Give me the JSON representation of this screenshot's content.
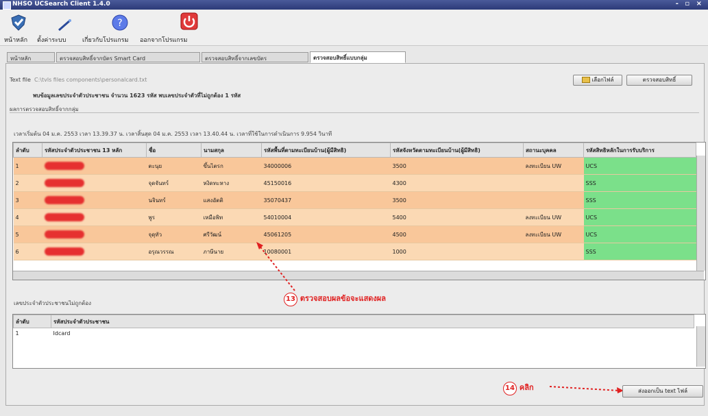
{
  "window": {
    "title": "NHSO UCSearch Client 1.4.0",
    "controls": "- ▫ ×"
  },
  "toolbar": {
    "items": [
      {
        "label": "หน้าหลัก",
        "icon": "home-shield-icon"
      },
      {
        "label": "ตั้งค่าระบบ",
        "icon": "settings-wand-icon"
      },
      {
        "label": "เกี่ยวกับโปรแกรม",
        "icon": "help-icon"
      },
      {
        "label": "ออกจากโปรแกรม",
        "icon": "power-icon"
      }
    ]
  },
  "tabs": [
    {
      "label": "หน้าหลัก",
      "active": false
    },
    {
      "label": "ตรวจสอบสิทธิ์จากบัตร Smart Card",
      "active": false
    },
    {
      "label": "ตรวจสอบสิทธิ์จากเลขบัตร",
      "active": false
    },
    {
      "label": "ตรวจสอบสิทธิ์แบบกลุ่ม",
      "active": true
    }
  ],
  "file_row": {
    "label": "Text file",
    "path": "C:\\tvls files components\\personalcard.txt",
    "browse_label": "เลือกไฟล์",
    "check_label": "ตรวจสอบสิทธิ์"
  },
  "summary": "พบข้อมูลเลขประจำตัวประชาชน จำนวน 1623 รหัส พบเลขประจำตัวที่ไม่ถูกต้อง 1 รหัส",
  "section1_title": "ผลการตรวจสอบสิทธิ์จากกลุ่ม",
  "timing": "เวลาเริ่มต้น 04 ม.ค. 2553 เวลา 13.39.37 น.  เวลาสิ้นสุด 04 ม.ค. 2553 เวลา 13.40.44 น.  เวลาที่ใช้ในการดำเนินการ 9.954 วินาที",
  "grid": {
    "columns": [
      "ลำดับ",
      "รหัสประจำตัวประชาชน 13 หลัก",
      "ชื่อ",
      "นามสกุล",
      "รหัสพื้นที่ตามทะเบียนบ้าน(ผู้มีสิทธิ)",
      "รหัสจังหวัดตามทะเบียนบ้าน(ผู้มีสิทธิ)",
      "สถานะบุคคล",
      "รหัสสิทธิหลักในการรับบริการ"
    ],
    "rows": [
      {
        "no": "1",
        "first": "ตะนุย",
        "last": "ขึ้นไตรก",
        "area": "34000006",
        "prov": "3500",
        "status": "ลงทะเบียน UW",
        "right": "UCS"
      },
      {
        "no": "2",
        "first": "จุดจันทร์",
        "last": "หงิดทะหาง",
        "area": "45150016",
        "prov": "4300",
        "status": "",
        "right": "SSS"
      },
      {
        "no": "3",
        "first": "นจินทร์",
        "last": "แสงอัตติ",
        "area": "35070437",
        "prov": "3500",
        "status": "",
        "right": "SSS"
      },
      {
        "no": "4",
        "first": "พูร",
        "last": "เหมือพิท",
        "area": "54010004",
        "prov": "5400",
        "status": "ลงทะเบียน UW",
        "right": "UCS"
      },
      {
        "no": "5",
        "first": "จุดุทัว",
        "last": "ศรีวัฒน์",
        "area": "45061205",
        "prov": "4500",
        "status": "ลงทะเบียน UW",
        "right": "UCS"
      },
      {
        "no": "6",
        "first": "อรุณวรรณ",
        "last": "ภาษีนาย",
        "area": "10080001",
        "prov": "1000",
        "status": "",
        "right": "SSS"
      }
    ]
  },
  "section2_title": "เลขประจำตัวประชาชนไม่ถูกต้อง",
  "grid2": {
    "columns": [
      "ลำดับ",
      "รหัสประจำตัวประชาชน"
    ],
    "rows": [
      {
        "no": "1",
        "id": "Idcard"
      }
    ]
  },
  "export_label": "ส่งออกเป็น text ไฟล์",
  "annotations": {
    "callout13_num": "13",
    "callout13_text": "ตรวจสอบผลข้อจะแสดงผล",
    "callout14_num": "14",
    "callout14_text": "คลิก"
  },
  "colors": {
    "row_odd": "#f9c79a",
    "row_even": "#fbd9b4",
    "right_col": "#7be08a",
    "annotation": "#e02020"
  }
}
